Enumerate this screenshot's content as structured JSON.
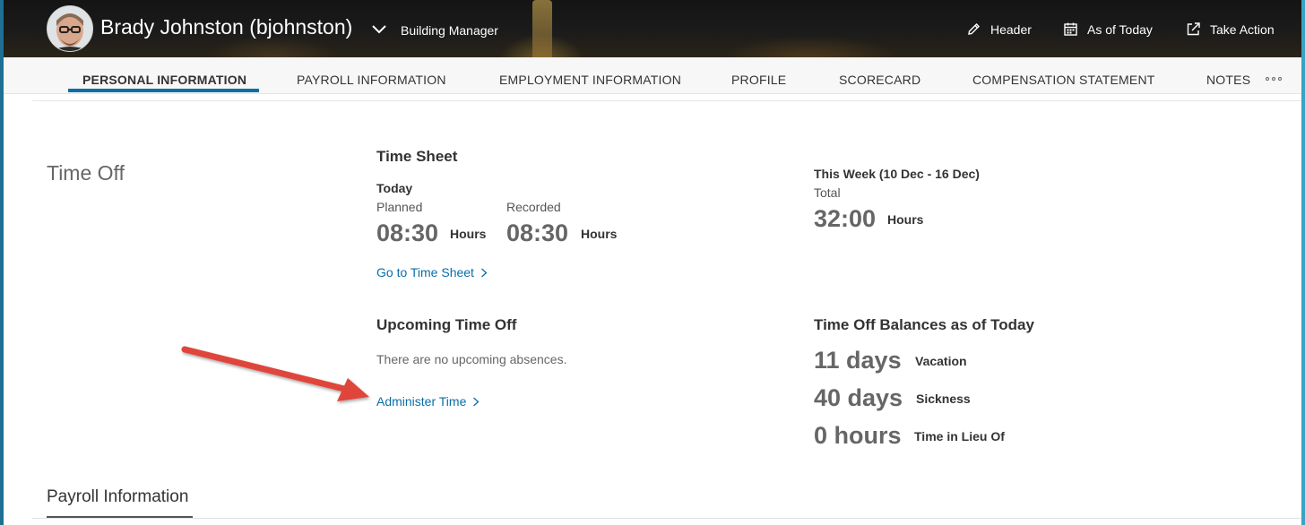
{
  "header": {
    "user_name": "Brady Johnston (bjohnston)",
    "role": "Building Manager",
    "actions": [
      {
        "label": "Header",
        "icon": "pencil-icon"
      },
      {
        "label": "As of Today",
        "icon": "calendar-icon"
      },
      {
        "label": "Take Action",
        "icon": "external-action-icon"
      }
    ]
  },
  "tabs": [
    {
      "label": "PERSONAL INFORMATION",
      "active": true
    },
    {
      "label": "PAYROLL INFORMATION",
      "active": false
    },
    {
      "label": "EMPLOYMENT INFORMATION",
      "active": false
    },
    {
      "label": "PROFILE",
      "active": false
    },
    {
      "label": "SCORECARD",
      "active": false
    },
    {
      "label": "COMPENSATION STATEMENT",
      "active": false
    },
    {
      "label": "NOTES",
      "active": false
    }
  ],
  "time_off": {
    "section_title": "Time Off",
    "time_sheet": {
      "title": "Time Sheet",
      "today_label": "Today",
      "planned_label": "Planned",
      "planned_value": "08:30",
      "planned_unit": "Hours",
      "recorded_label": "Recorded",
      "recorded_value": "08:30",
      "recorded_unit": "Hours",
      "link": "Go to Time Sheet"
    },
    "this_week": {
      "title": "This Week (10 Dec - 16 Dec)",
      "total_label": "Total",
      "total_value": "32:00",
      "total_unit": "Hours"
    },
    "upcoming": {
      "title": "Upcoming Time Off",
      "empty_text": "There are no upcoming absences.",
      "link": "Administer Time"
    },
    "balances": {
      "title": "Time Off Balances as of Today",
      "items": [
        {
          "value": "11 days",
          "label": "Vacation"
        },
        {
          "value": "40 days",
          "label": "Sickness"
        },
        {
          "value": "0 hours",
          "label": "Time in Lieu Of"
        }
      ]
    }
  },
  "next_section": {
    "title": "Payroll Information"
  },
  "colors": {
    "accent": "#0a6ea8",
    "annotation_arrow": "#e0443a"
  }
}
